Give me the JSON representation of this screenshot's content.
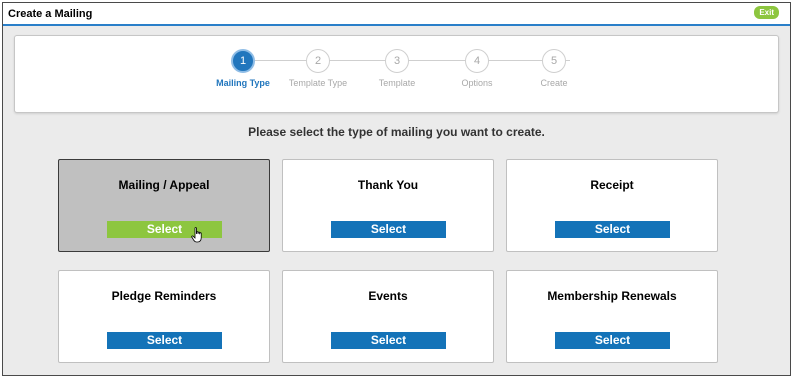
{
  "window": {
    "title": "Create a Mailing",
    "exit_label": "Exit"
  },
  "stepper": {
    "steps": [
      {
        "number": "1",
        "label": "Mailing Type",
        "active": true
      },
      {
        "number": "2",
        "label": "Template Type",
        "active": false
      },
      {
        "number": "3",
        "label": "Template",
        "active": false
      },
      {
        "number": "4",
        "label": "Options",
        "active": false
      },
      {
        "number": "5",
        "label": "Create",
        "active": false
      }
    ]
  },
  "prompt": "Please select the type of mailing you want to create.",
  "cards": [
    {
      "title": "Mailing / Appeal",
      "button": "Select",
      "selected": true
    },
    {
      "title": "Thank You",
      "button": "Select",
      "selected": false
    },
    {
      "title": "Receipt",
      "button": "Select",
      "selected": false
    },
    {
      "title": "Pledge Reminders",
      "button": "Select",
      "selected": false
    },
    {
      "title": "Events",
      "button": "Select",
      "selected": false
    },
    {
      "title": "Membership Renewals",
      "button": "Select",
      "selected": false
    }
  ],
  "colors": {
    "accent_blue": "#1473b8",
    "active_green": "#8dc63f",
    "title_underline": "#2a7fc9"
  },
  "icons": {
    "cursor": "hand-pointer-icon"
  }
}
